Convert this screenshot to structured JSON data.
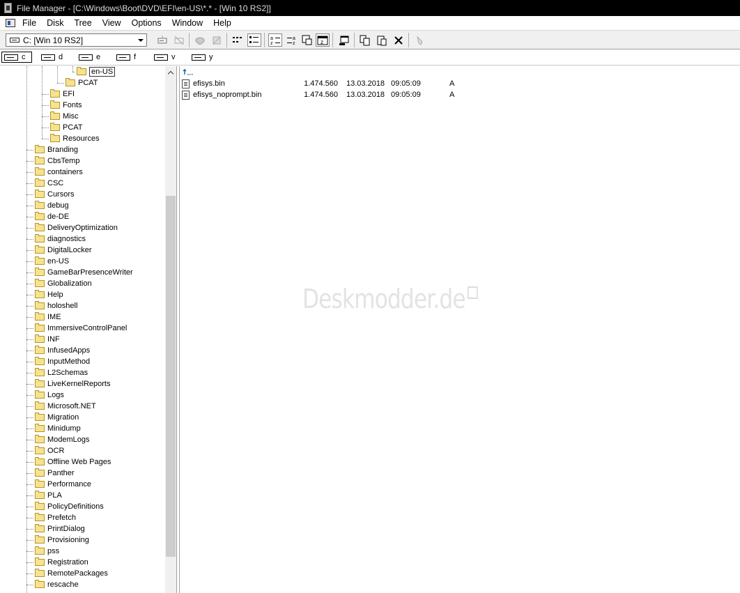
{
  "window": {
    "title": "File Manager - [C:\\Windows\\Boot\\DVD\\EFI\\en-US\\*.* - [Win 10 RS2]]"
  },
  "menu": [
    "File",
    "Disk",
    "Tree",
    "View",
    "Options",
    "Window",
    "Help"
  ],
  "toolbar": {
    "drive_value": "C: [Win 10 RS2]",
    "buttons": [
      {
        "name": "connect-drive-button",
        "icon": "connect-icon"
      },
      {
        "name": "disconnect-drive-button",
        "icon": "disconnect-icon"
      },
      {
        "name": "share-button",
        "icon": "share-icon"
      },
      {
        "name": "stop-sharing-button",
        "icon": "stop-share-icon"
      },
      {
        "name": "view-name-button",
        "icon": "list-name-icon"
      },
      {
        "name": "view-details-button",
        "icon": "list-details-icon",
        "pressed": true
      },
      {
        "name": "sort-by-name-button",
        "icon": "sort-name-icon",
        "pressed": true
      },
      {
        "name": "sort-by-type-button",
        "icon": "sort-type-icon"
      },
      {
        "name": "new-window-button",
        "icon": "new-window-icon"
      },
      {
        "name": "properties-button",
        "icon": "properties-icon"
      },
      {
        "name": "minimize-on-use-button",
        "icon": "minimize-icon"
      },
      {
        "name": "copy-button",
        "icon": "copy-icon"
      },
      {
        "name": "paste-button",
        "icon": "paste-icon"
      },
      {
        "name": "delete-button",
        "icon": "delete-icon"
      },
      {
        "name": "undo-button",
        "icon": "undo-icon"
      }
    ]
  },
  "drives": [
    {
      "letter": "c",
      "selected": true
    },
    {
      "letter": "d"
    },
    {
      "letter": "e"
    },
    {
      "letter": "f"
    },
    {
      "letter": "v"
    },
    {
      "letter": "y"
    }
  ],
  "tree": {
    "items": [
      {
        "label": "en-US",
        "selected": true,
        "open": true
      },
      {
        "label": "PCAT"
      },
      {
        "label": "EFI"
      },
      {
        "label": "Fonts"
      },
      {
        "label": "Misc"
      },
      {
        "label": "PCAT"
      },
      {
        "label": "Resources"
      },
      {
        "label": "Branding"
      },
      {
        "label": "CbsTemp"
      },
      {
        "label": "containers"
      },
      {
        "label": "CSC"
      },
      {
        "label": "Cursors"
      },
      {
        "label": "debug"
      },
      {
        "label": "de-DE"
      },
      {
        "label": "DeliveryOptimization"
      },
      {
        "label": "diagnostics"
      },
      {
        "label": "DigitalLocker"
      },
      {
        "label": "en-US"
      },
      {
        "label": "GameBarPresenceWriter"
      },
      {
        "label": "Globalization"
      },
      {
        "label": "Help"
      },
      {
        "label": "holoshell"
      },
      {
        "label": "IME"
      },
      {
        "label": "ImmersiveControlPanel"
      },
      {
        "label": "INF"
      },
      {
        "label": "InfusedApps"
      },
      {
        "label": "InputMethod"
      },
      {
        "label": "L2Schemas"
      },
      {
        "label": "LiveKernelReports"
      },
      {
        "label": "Logs"
      },
      {
        "label": "Microsoft.NET"
      },
      {
        "label": "Migration"
      },
      {
        "label": "Minidump"
      },
      {
        "label": "ModemLogs"
      },
      {
        "label": "OCR"
      },
      {
        "label": "Offline Web Pages"
      },
      {
        "label": "Panther"
      },
      {
        "label": "Performance"
      },
      {
        "label": "PLA"
      },
      {
        "label": "PolicyDefinitions"
      },
      {
        "label": "Prefetch"
      },
      {
        "label": "PrintDialog"
      },
      {
        "label": "Provisioning"
      },
      {
        "label": "pss"
      },
      {
        "label": "Registration"
      },
      {
        "label": "RemotePackages"
      },
      {
        "label": "rescache"
      }
    ]
  },
  "files": {
    "up_icon": "parent-folder-icon",
    "rows": [
      {
        "name": "efisys.bin",
        "size": "1.474.560",
        "date": "13.03.2018",
        "time": "09:05:09",
        "attr": "A"
      },
      {
        "name": "efisys_noprompt.bin",
        "size": "1.474.560",
        "date": "13.03.2018",
        "time": "09:05:09",
        "attr": "A"
      }
    ]
  },
  "watermark": "Deskmodder.de",
  "colors": {
    "folder": "#f7e38d",
    "titlebar": "#000000",
    "toolbar": "#f0f0f0"
  }
}
